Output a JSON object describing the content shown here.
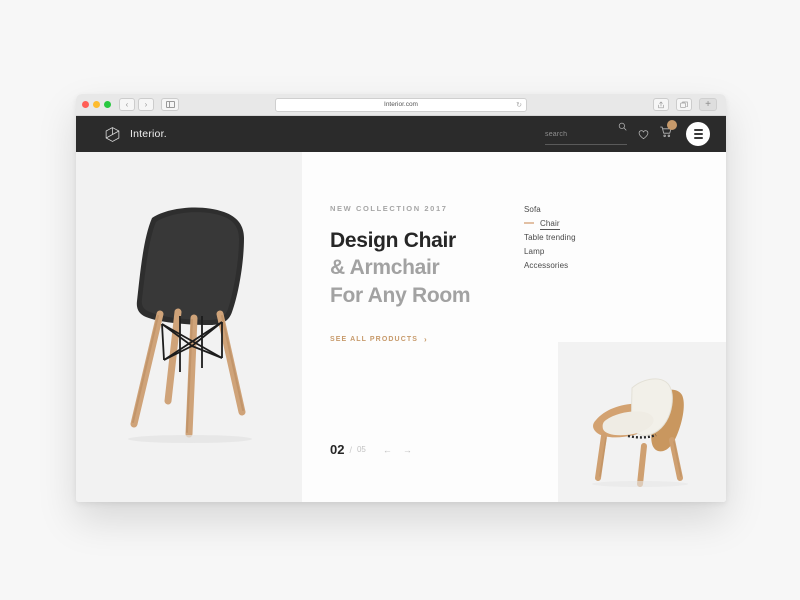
{
  "browser": {
    "url": "Interior.com",
    "back_label": "‹",
    "forward_label": "›",
    "sidebar_label": "sidebar-toggle",
    "reload_label": "↻",
    "share_label": "share",
    "tabs_label": "tabs",
    "new_tab_label": "+"
  },
  "nav": {
    "brand": "Interior.",
    "logo_icon": "hexagon-cube-icon",
    "search": {
      "placeholder": "search",
      "value": "",
      "icon": "search-icon"
    },
    "wishlist_icon": "heart-icon",
    "cart_icon": "cart-icon",
    "cart_badge": "",
    "menu_icon": "hamburger-icon"
  },
  "hero": {
    "eyebrow": "NEW COLLECTION 2017",
    "line1": "Design Chair",
    "line2": "& Armchair",
    "line3": "For Any Room",
    "cta_label": "SEE ALL PRODUCTS",
    "cta_chevron": "›",
    "product_image_alt": "black-eames-dsw-chair"
  },
  "pagination": {
    "current": "02",
    "separator": "/",
    "total": "05",
    "prev_arrow": "←",
    "next_arrow": "→"
  },
  "categories": {
    "active_index": 1,
    "items": [
      {
        "label": "Sofa"
      },
      {
        "label": "Chair"
      },
      {
        "label": "Table trending"
      },
      {
        "label": "Lamp"
      },
      {
        "label": "Accessories"
      }
    ]
  },
  "secondary_card": {
    "product_image_alt": "wegner-shell-chair-cream"
  },
  "colors": {
    "accent": "#c8834a",
    "cta": "#c79a6b",
    "nav_bg": "#2b2b2b",
    "panel_bg": "#f2f2f2",
    "page_bg": "#f7f7f7",
    "heading_dark": "#262626",
    "heading_grey": "#a2a2a2"
  }
}
